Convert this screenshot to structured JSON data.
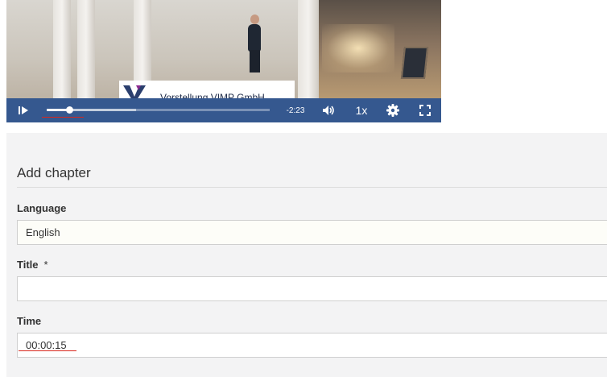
{
  "video": {
    "banner_text": "Vorstellung VIMP GmbH",
    "time_remaining": "-2:23",
    "speed_label": "1x",
    "progress_played": 0.1,
    "progress_buffered": 0.4,
    "control_bar_color": "#35588f",
    "icons": [
      "play-icon",
      "volume-icon",
      "settings-icon",
      "fullscreen-icon"
    ]
  },
  "form": {
    "title": "Add chapter",
    "language_label": "Language",
    "language_value": "English",
    "title_label": "Title",
    "required_marker": "*",
    "title_value": "",
    "time_label": "Time",
    "time_value": "00:00:15",
    "annotation_color": "#d9261c"
  }
}
